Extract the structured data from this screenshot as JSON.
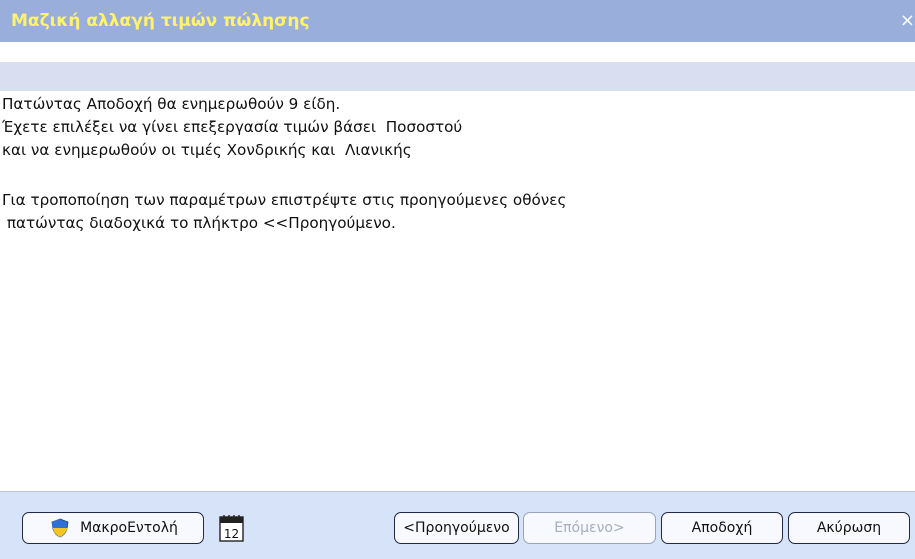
{
  "window": {
    "title": "Μαζική αλλαγή τιμών πώλησης",
    "close_glyph": "×"
  },
  "message": {
    "lines": [
      "Πατώντας Αποδοχή θα ενημερωθούν 9 είδη.",
      "Έχετε επιλέξει να γίνει επεξεργασία τιμών βάσει  Ποσοστού",
      "και να ενημερωθούν οι τιμές Χονδρικής και  Λιανικής",
      "",
      "Για τροποποίηση των παραμέτρων επιστρέψτε στις προηγούμενες οθόνες",
      " πατώντας διαδοχικά το πλήκτρο <<Προηγούμενο."
    ]
  },
  "footer": {
    "macro_label": "ΜακροΕντολή",
    "calendar_day": "12",
    "prev_label": "<Προηγούμενο",
    "next_label": "Επόμενο>",
    "accept_label": "Αποδοχή",
    "cancel_label": "Ακύρωση"
  },
  "colors": {
    "titlebar": "#9aaedc",
    "title_text": "#fff36a",
    "footer": "#d6e3f8"
  }
}
